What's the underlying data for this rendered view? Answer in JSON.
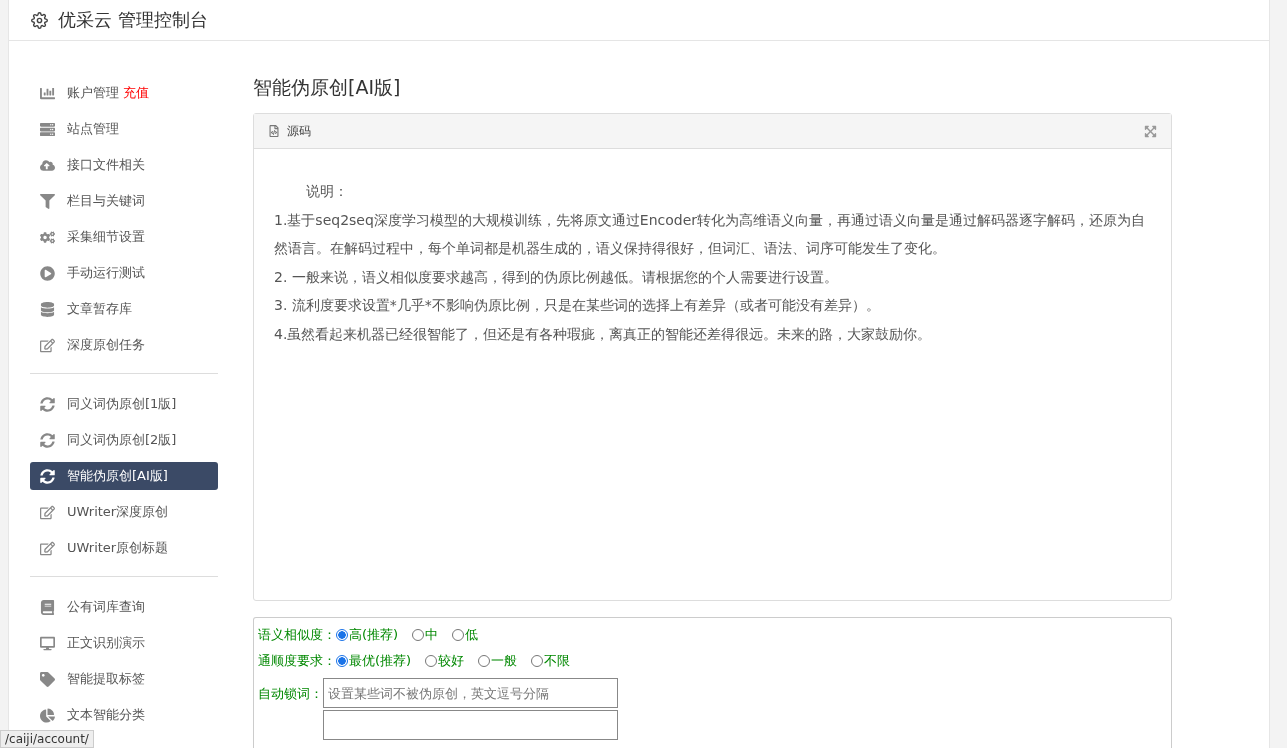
{
  "header": {
    "title": "优采云 管理控制台"
  },
  "sidebar": {
    "groups": [
      {
        "items": [
          {
            "label": "账户管理",
            "badge": "充值",
            "kind": "chart",
            "selected": false
          },
          {
            "label": "站点管理",
            "kind": "server",
            "selected": false
          },
          {
            "label": "接口文件相关",
            "kind": "cloud",
            "selected": false
          },
          {
            "label": "栏目与关键词",
            "kind": "filter",
            "selected": false
          },
          {
            "label": "采集细节设置",
            "kind": "cogs",
            "selected": false
          },
          {
            "label": "手动运行测试",
            "kind": "play",
            "selected": false
          },
          {
            "label": "文章暂存库",
            "kind": "database",
            "selected": false
          },
          {
            "label": "深度原创任务",
            "kind": "edit",
            "selected": false
          }
        ]
      },
      {
        "items": [
          {
            "label": "同义词伪原创[1版]",
            "kind": "refresh",
            "selected": false
          },
          {
            "label": "同义词伪原创[2版]",
            "kind": "refresh",
            "selected": false
          },
          {
            "label": "智能伪原创[AI版]",
            "kind": "refresh",
            "selected": true
          },
          {
            "label": "UWriter深度原创",
            "kind": "edit",
            "selected": false
          },
          {
            "label": "UWriter原创标题",
            "kind": "edit",
            "selected": false
          }
        ]
      },
      {
        "items": [
          {
            "label": "公有词库查询",
            "kind": "book",
            "selected": false
          },
          {
            "label": "正文识别演示",
            "kind": "desktop",
            "selected": false
          },
          {
            "label": "智能提取标签",
            "kind": "tag",
            "selected": false
          },
          {
            "label": "文本智能分类",
            "kind": "pie",
            "selected": false
          }
        ]
      }
    ]
  },
  "page_title": "智能伪原创[AI版]",
  "editor": {
    "tab": "源码",
    "lines": [
      "说明：",
      "1.基于seq2seq深度学习模型的大规模训练，先将原文通过Encoder转化为高维语义向量，再通过语义向量是通过解码器逐字解码，还原为自然语言。在解码过程中，每个单词都是机器生成的，语义保持得很好，但词汇、语法、词序可能发生了变化。",
      "2. 一般来说，语义相似度要求越高，得到的伪原比例越低。请根据您的个人需要进行设置。",
      "3. 流利度要求设置*几乎*不影响伪原比例，只是在某些词的选择上有差异（或者可能没有差异）。",
      "4.虽然看起来机器已经很智能了，但还是有各种瑕疵，离真正的智能还差得很远。未来的路，大家鼓励你。"
    ]
  },
  "options": [
    {
      "label": "语义相似度：",
      "choices": [
        {
          "label": "高(推荐)",
          "selected": true
        },
        {
          "label": "中",
          "selected": false
        },
        {
          "label": "低",
          "selected": false
        }
      ]
    },
    {
      "label": "通顺度要求：",
      "choices": [
        {
          "label": "最优(推荐)",
          "selected": true
        },
        {
          "label": "较好",
          "selected": false
        },
        {
          "label": "一般",
          "selected": false
        },
        {
          "label": "不限",
          "selected": false
        }
      ]
    }
  ],
  "lock_words": {
    "label": "自动锁词：",
    "placeholder": "设置某些词不被伪原创，英文逗号分隔"
  },
  "status_url": "/caiji/account/"
}
